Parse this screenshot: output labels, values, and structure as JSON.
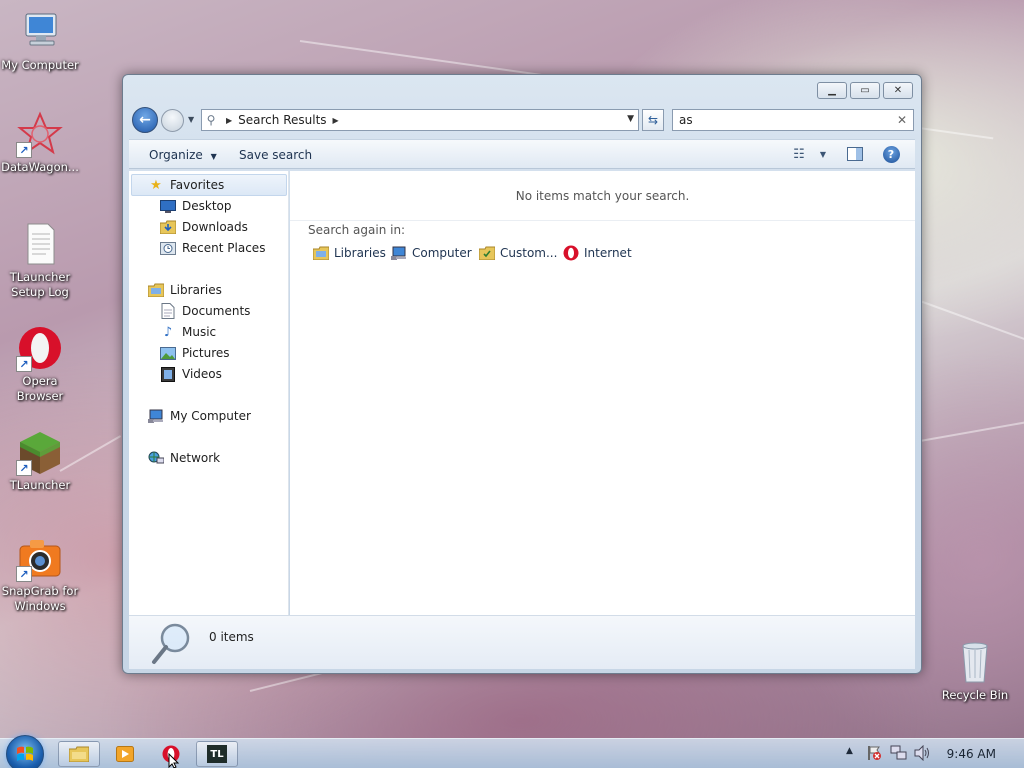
{
  "desktop": {
    "icons": [
      {
        "label": "My Computer"
      },
      {
        "label": "DataWagon..."
      },
      {
        "label": "TLauncher Setup Log"
      },
      {
        "label": "Opera Browser"
      },
      {
        "label": "TLauncher"
      },
      {
        "label": "SnapGrab for Windows"
      },
      {
        "label": "Recycle Bin"
      }
    ]
  },
  "window": {
    "address": {
      "crumb": "Search Results"
    },
    "search": {
      "value": "as"
    },
    "toolbar": {
      "organize": "Organize",
      "save_search": "Save search"
    },
    "nav": {
      "favorites": "Favorites",
      "desktop": "Desktop",
      "downloads": "Downloads",
      "recent_places": "Recent Places",
      "libraries": "Libraries",
      "documents": "Documents",
      "music": "Music",
      "pictures": "Pictures",
      "videos": "Videos",
      "my_computer": "My Computer",
      "network": "Network"
    },
    "content": {
      "no_items": "No items match your search.",
      "search_again": "Search again in:",
      "targets": [
        "Libraries",
        "Computer",
        "Custom...",
        "Internet"
      ]
    },
    "details": {
      "count": "0 items"
    }
  },
  "taskbar": {
    "clock": "9:46 AM",
    "apps": [
      "Windows Explorer",
      "Media Player",
      "Opera",
      "TLauncher"
    ],
    "tl_label": "TL"
  },
  "colors": {
    "accent": "#1f57a8",
    "opera_red": "#d8102a",
    "window_frame": "#c9d8e8"
  }
}
